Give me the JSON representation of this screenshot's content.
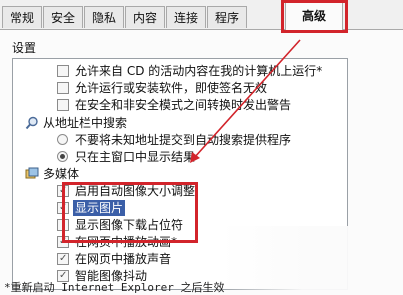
{
  "tabs": [
    {
      "label": "常规"
    },
    {
      "label": "安全"
    },
    {
      "label": "隐私"
    },
    {
      "label": "内容"
    },
    {
      "label": "连接"
    },
    {
      "label": "程序"
    },
    {
      "label": "高级"
    }
  ],
  "active_tab": "高级",
  "group_title": "设置",
  "settings": {
    "top_items": [
      {
        "label": "允许来自 CD 的活动内容在我的计算机上运行*",
        "checked": false
      },
      {
        "label": "允许运行或安装软件，即使签名无效",
        "checked": false
      },
      {
        "label": "在安全和非安全模式之间转换时发出警告",
        "checked": false
      }
    ],
    "search_category": "从地址栏中搜索",
    "search_options": [
      {
        "label": "不要将未知地址提交到自动搜索提供程序",
        "checked": false
      },
      {
        "label": "只在主窗口中显示结果",
        "checked": true
      }
    ],
    "media_category": "多媒体",
    "media_items": [
      {
        "label": "启用自动图像大小调整",
        "checked": true
      },
      {
        "label": "显示图片",
        "checked": true
      },
      {
        "label": "显示图像下载占位符",
        "checked": false
      },
      {
        "label": "在网页中播放动画*",
        "checked": true
      },
      {
        "label": "在网页中播放声音",
        "checked": true
      },
      {
        "label": "智能图像抖动",
        "checked": true
      }
    ]
  },
  "footnote": "*重新启动 Internet Explorer 之后生效",
  "colors": {
    "annotation_red": "#d2242b",
    "selection_blue": "#3b5fa8"
  }
}
